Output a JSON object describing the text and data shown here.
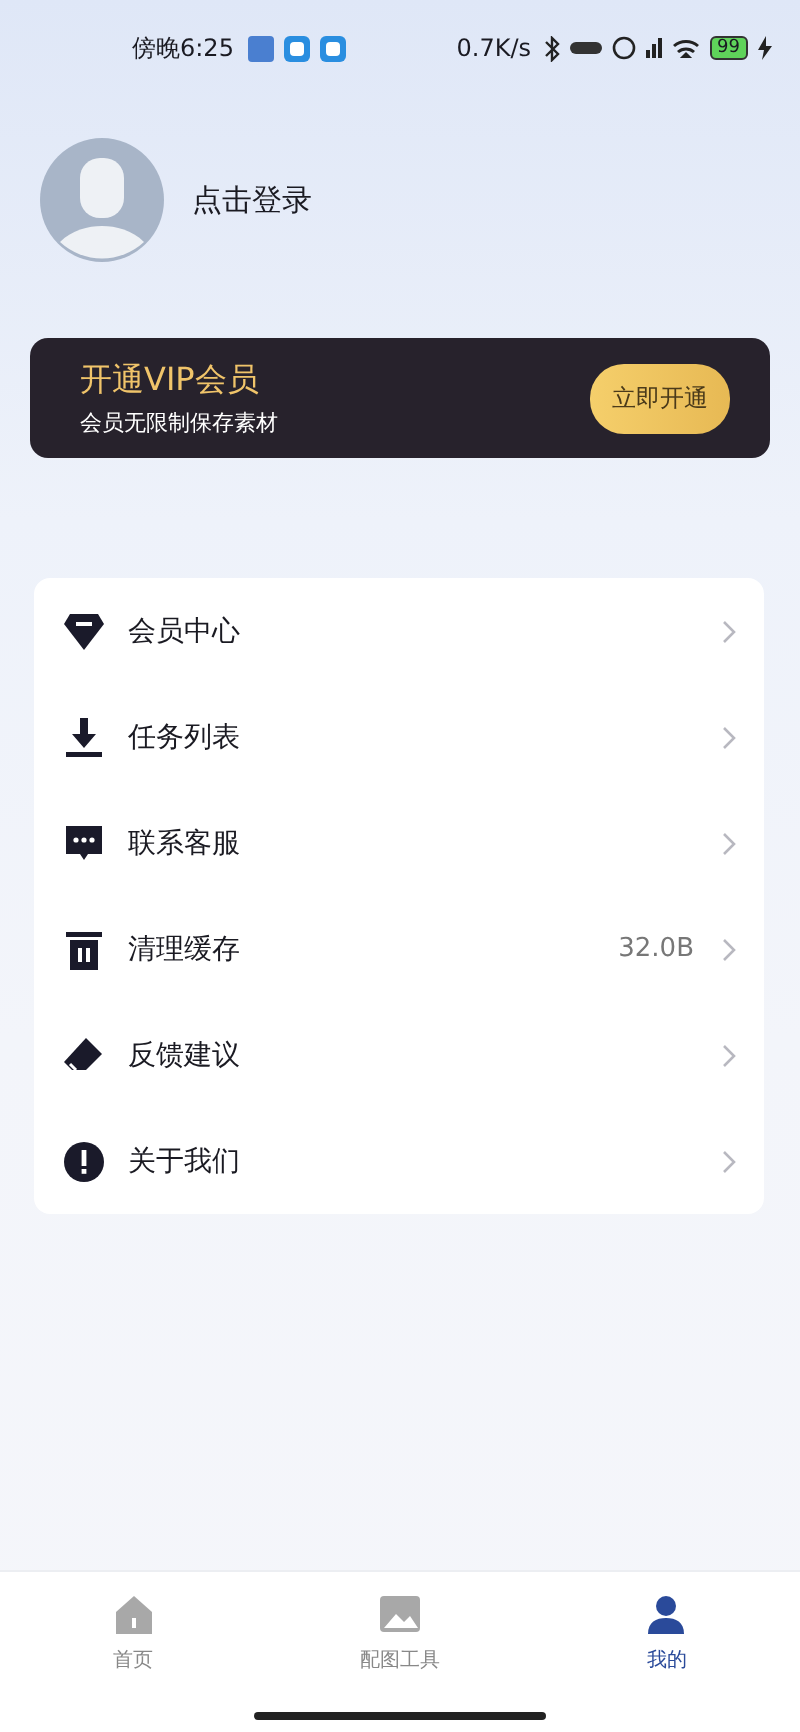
{
  "status_bar": {
    "time": "傍晚6:25",
    "speed": "0.7K/s",
    "battery": "99"
  },
  "profile": {
    "login_text": "点击登录"
  },
  "vip_banner": {
    "title": "开通VIP会员",
    "subtitle": "会员无限制保存素材",
    "button": "立即开通"
  },
  "menu": [
    {
      "kind": "gem",
      "label": "会员中心"
    },
    {
      "kind": "download",
      "label": "任务列表"
    },
    {
      "kind": "chat",
      "label": "联系客服"
    },
    {
      "kind": "trash",
      "label": "清理缓存",
      "value": "32.0B"
    },
    {
      "kind": "eraser",
      "label": "反馈建议"
    },
    {
      "kind": "info",
      "label": "关于我们"
    }
  ],
  "tab_bar": [
    {
      "kind": "home",
      "label": "首页",
      "selected": false
    },
    {
      "kind": "image",
      "label": "配图工具",
      "selected": false
    },
    {
      "kind": "person",
      "label": "我的",
      "selected": true
    }
  ]
}
